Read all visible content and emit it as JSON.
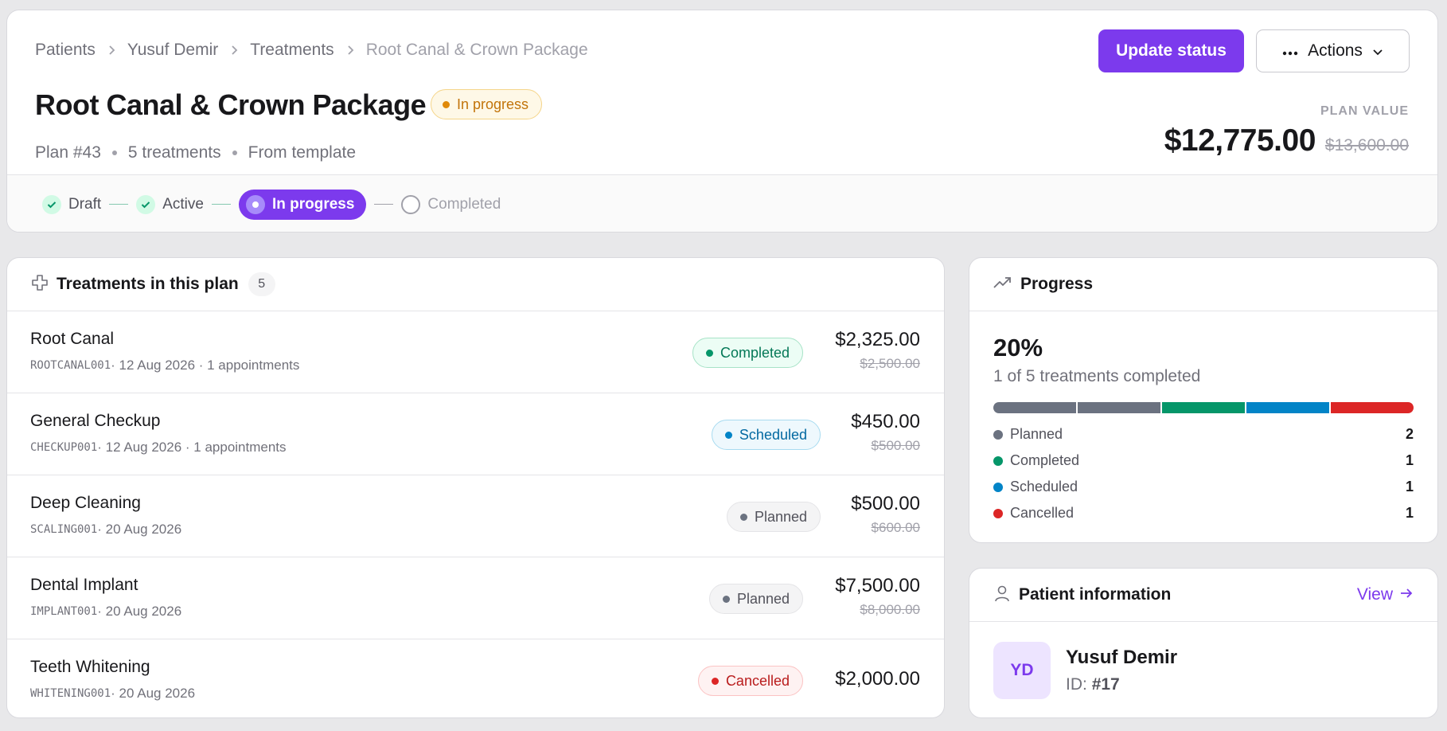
{
  "breadcrumb": [
    "Patients",
    "Yusuf Demir",
    "Treatments",
    "Root Canal & Crown Package"
  ],
  "plan": {
    "title": "Root Canal & Crown Package",
    "status": "In progress",
    "meta": [
      "Plan #43",
      "5 treatments",
      "From template"
    ],
    "value_label": "PLAN VALUE",
    "value": "$12,775.00",
    "original_value": "$13,600.00"
  },
  "actions": {
    "update_status": "Update status",
    "actions": "Actions"
  },
  "stepper": [
    {
      "label": "Draft",
      "state": "done"
    },
    {
      "label": "Active",
      "state": "done"
    },
    {
      "label": "In progress",
      "state": "current"
    },
    {
      "label": "Completed",
      "state": "todo"
    }
  ],
  "treatments": {
    "title": "Treatments in this plan",
    "count": "5",
    "rows": [
      {
        "name": "Root Canal",
        "code": "ROOTCANAL001",
        "details": " · 12 Aug 2026 · 1 appointments",
        "status": "Completed",
        "status_key": "completed",
        "price": "$2,325.00",
        "original_price": "$2,500.00"
      },
      {
        "name": "General Checkup",
        "code": "CHECKUP001",
        "details": " · 12 Aug 2026 · 1 appointments",
        "status": "Scheduled",
        "status_key": "scheduled",
        "price": "$450.00",
        "original_price": "$500.00"
      },
      {
        "name": "Deep Cleaning",
        "code": "SCALING001",
        "details": " · 20 Aug 2026",
        "status": "Planned",
        "status_key": "planned",
        "price": "$500.00",
        "original_price": "$600.00"
      },
      {
        "name": "Dental Implant",
        "code": "IMPLANT001",
        "details": " · 20 Aug 2026",
        "status": "Planned",
        "status_key": "planned",
        "price": "$7,500.00",
        "original_price": "$8,000.00"
      },
      {
        "name": "Teeth Whitening",
        "code": "WHITENING001",
        "details": " · 20 Aug 2026",
        "status": "Cancelled",
        "status_key": "cancelled",
        "price": "$2,000.00",
        "original_price": ""
      }
    ]
  },
  "progress": {
    "title": "Progress",
    "percent": "20%",
    "summary": "1 of 5 treatments completed",
    "breakdown": [
      {
        "label": "Planned",
        "count": 2,
        "color": "#6b7280"
      },
      {
        "label": "Completed",
        "count": 1,
        "color": "#059669"
      },
      {
        "label": "Scheduled",
        "count": 1,
        "color": "#0284c7"
      },
      {
        "label": "Cancelled",
        "count": 1,
        "color": "#dc2626"
      }
    ]
  },
  "patient": {
    "title": "Patient information",
    "view_label": "View",
    "initials": "YD",
    "name": "Yusuf Demir",
    "id_label": "ID:",
    "id": "#17"
  },
  "colors": {
    "accent": "#7c3aed",
    "in_progress_text": "#c2740a",
    "completed": "#059669",
    "scheduled": "#0284c7",
    "planned": "#6b7280",
    "cancelled": "#dc2626"
  }
}
